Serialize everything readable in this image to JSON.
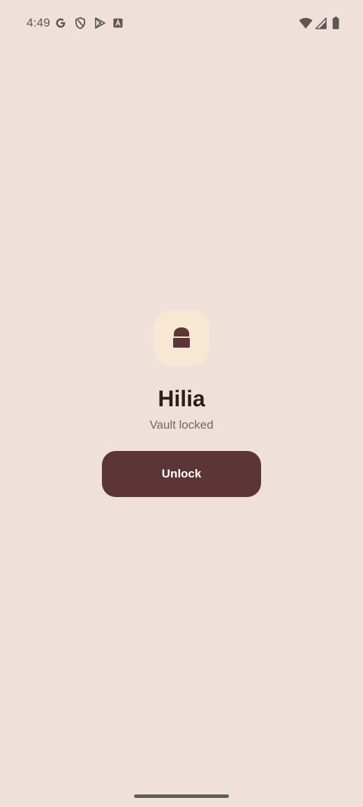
{
  "status_bar": {
    "time": "4:49",
    "left_icons": [
      "google-icon",
      "shield-icon",
      "play-store-icon",
      "text-a-icon"
    ],
    "right_icons": [
      "wifi-icon",
      "cellular-signal-icon",
      "battery-icon"
    ]
  },
  "vault": {
    "icon": "lock-icon",
    "title": "Hilia",
    "status": "Vault locked",
    "unlock_label": "Unlock"
  },
  "colors": {
    "background": "#EFE0D9",
    "badge": "#F8E8D3",
    "primary": "#5C3636",
    "title": "#2E1D1B",
    "subtitle": "#776461"
  }
}
